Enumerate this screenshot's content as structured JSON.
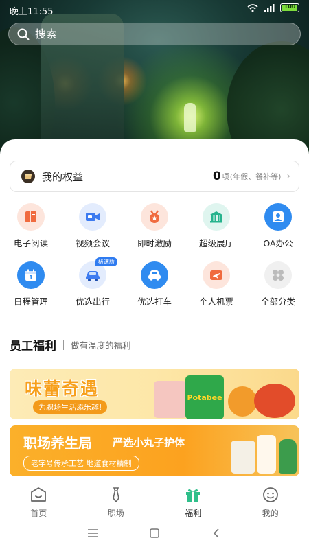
{
  "status": {
    "time": "晚上11:55",
    "battery": "100"
  },
  "search": {
    "placeholder": "搜索"
  },
  "benefits": {
    "title": "我的权益",
    "count": "0",
    "unit": "项",
    "desc": "(年假、餐补等)"
  },
  "grid": [
    {
      "label": "电子阅读",
      "icon": "book-icon",
      "bg": "#fde5dc",
      "fg": "#f06b3f"
    },
    {
      "label": "视频会议",
      "icon": "video-camera-icon",
      "bg": "#e3ecfd",
      "fg": "#3d7bf0"
    },
    {
      "label": "即时激励",
      "icon": "medal-star-icon",
      "bg": "#fde5dc",
      "fg": "#f06b3f"
    },
    {
      "label": "超级展厅",
      "icon": "hall-icon",
      "bg": "#dff5ef",
      "fg": "#26b38d"
    },
    {
      "label": "OA办公",
      "icon": "person-card-icon",
      "bg": "#2f8bf0",
      "fg": "#ffffff"
    },
    {
      "label": "日程管理",
      "icon": "calendar-icon",
      "bg": "#2f8bf0",
      "fg": "#ffffff"
    },
    {
      "label": "优选出行",
      "icon": "car-icon",
      "bg": "#e3ecfd",
      "fg": "#3d7bf0",
      "badge": "极速版"
    },
    {
      "label": "优选打车",
      "icon": "taxi-icon",
      "bg": "#2f8bf0",
      "fg": "#ffffff"
    },
    {
      "label": "个人机票",
      "icon": "plane-icon",
      "bg": "#fde5dc",
      "fg": "#f06b3f"
    },
    {
      "label": "全部分类",
      "icon": "all-categories-icon",
      "bg": "#f0f0f0",
      "fg": "#bbbbbb"
    }
  ],
  "section": {
    "title": "员工福利",
    "subtitle": "做有温度的福利"
  },
  "banners": [
    {
      "title": "味蕾奇遇",
      "subtitle": "为职场生活添乐趣!",
      "product": "Potabee"
    },
    {
      "title": "职场养生局",
      "title2": "严选小丸子护体",
      "subtitle": "老字号传承工艺  地道食材精制"
    }
  ],
  "tabs": [
    {
      "label": "首页",
      "icon": "home-icon"
    },
    {
      "label": "职场",
      "icon": "tie-icon"
    },
    {
      "label": "福利",
      "icon": "gift-icon",
      "active": true
    },
    {
      "label": "我的",
      "icon": "smiley-icon"
    }
  ],
  "colors": {
    "accent": "#2fbf8a",
    "orange": "#f7a01c",
    "blue": "#2f8bf0"
  }
}
